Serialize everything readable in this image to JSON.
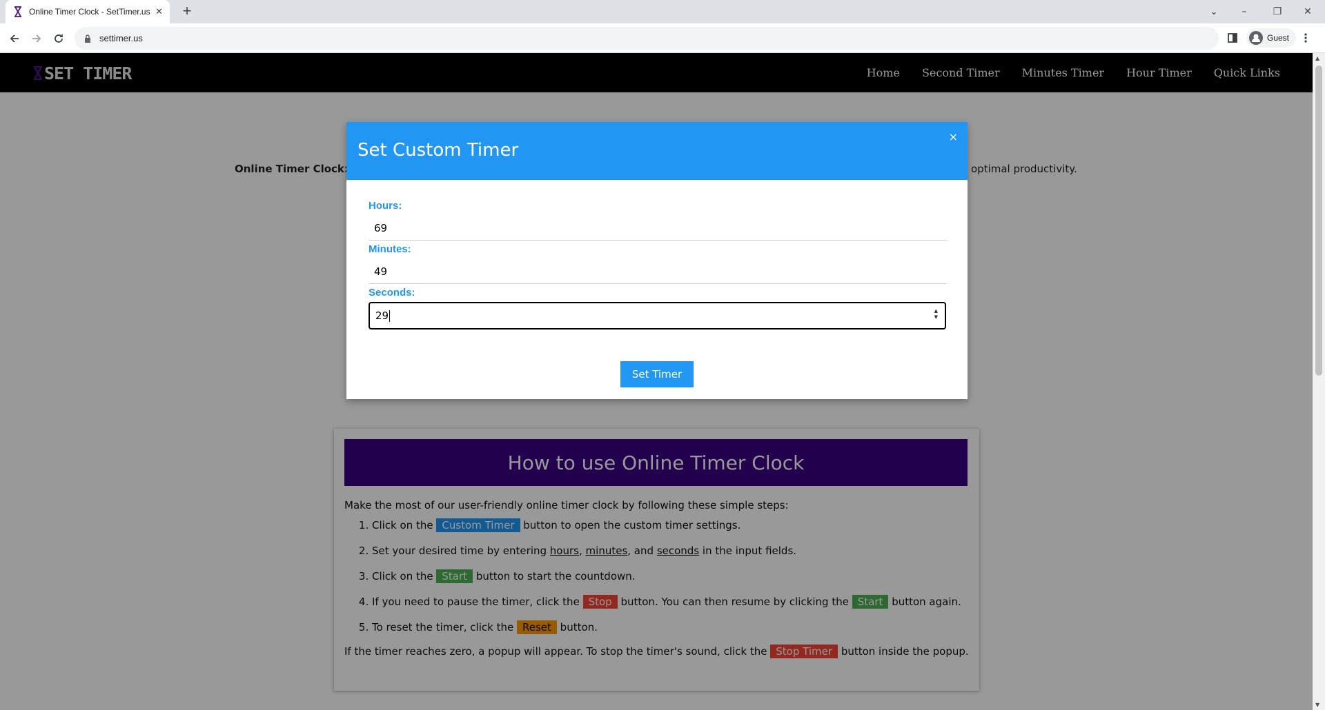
{
  "browser": {
    "tab_title": "Online Timer Clock - SetTimer.us",
    "url": "settimer.us",
    "profile_label": "Guest"
  },
  "site": {
    "logo_text": "SET TIMER",
    "nav": [
      "Home",
      "Second Timer",
      "Minutes Timer",
      "Hour Timer",
      "Quick Links"
    ],
    "intro_bold": "Online Timer Clock:",
    "intro_tail": "optimal productivity."
  },
  "modal": {
    "title": "Set Custom Timer",
    "close": "×",
    "hours_label": "Hours:",
    "hours_value": "69",
    "minutes_label": "Minutes:",
    "minutes_value": "49",
    "seconds_label": "Seconds:",
    "seconds_value": "29",
    "submit_label": "Set Timer"
  },
  "howto": {
    "heading": "How to use Online Timer Clock",
    "intro": "Make the most of our user-friendly online timer clock by following these simple steps:",
    "step1_a": "Click on the",
    "step1_chip": "Custom Timer",
    "step1_b": "button to open the custom timer settings.",
    "step2_a": "Set your desired time by entering",
    "step2_hours": "hours",
    "step2_comma": ",",
    "step2_minutes": "minutes",
    "step2_and": ", and",
    "step2_seconds": "seconds",
    "step2_b": "in the input fields.",
    "step3_a": "Click on the",
    "step3_chip": "Start",
    "step3_b": "button to start the countdown.",
    "step4_a": "If you need to pause the timer, click the",
    "step4_chip1": "Stop",
    "step4_b": "button. You can then resume by clicking the",
    "step4_chip2": "Start",
    "step4_c": "button again.",
    "step5_a": "To reset the timer, click the",
    "step5_chip": "Reset",
    "step5_b": "button.",
    "outro_a": "If the timer reaches zero, a popup will appear. To stop the timer's sound, click the",
    "outro_chip": "Stop Timer",
    "outro_b": "button inside the popup."
  },
  "colors": {
    "modal_accent": "#2196f3",
    "howto_header": "#3a0080",
    "start_chip": "#4caf50",
    "stop_chip": "#f44336",
    "reset_chip": "#ff9800"
  }
}
